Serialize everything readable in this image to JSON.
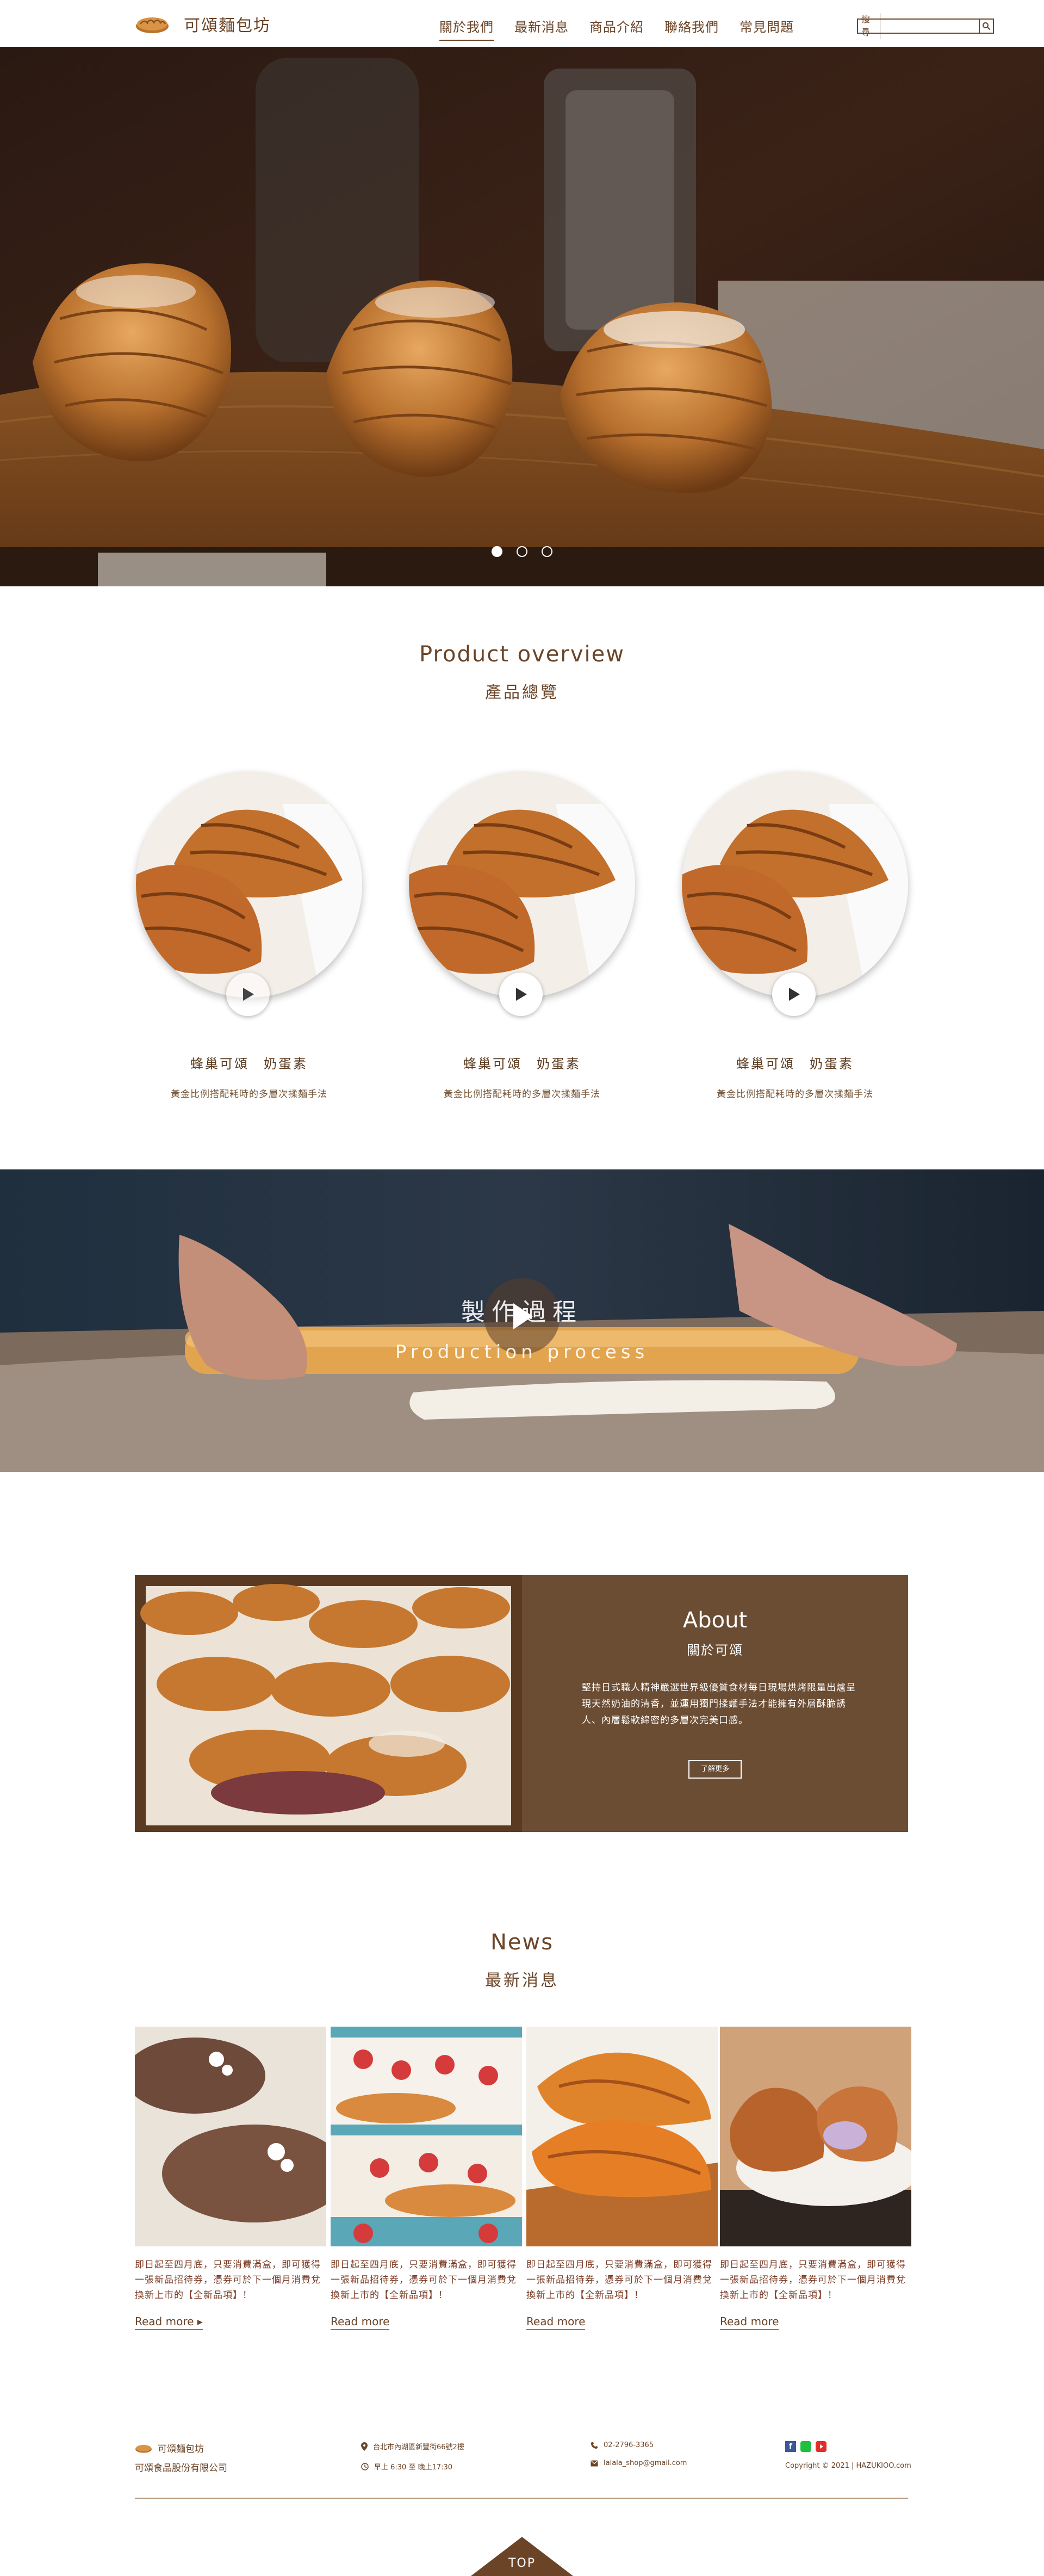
{
  "header": {
    "brand": "可頌麵包坊",
    "nav": [
      "關於我們",
      "最新消息",
      "商品介紹",
      "聯絡我們",
      "常見問題"
    ],
    "search_label": "搜尋"
  },
  "hero": {
    "slide_count": 3,
    "active_slide": 1
  },
  "products": {
    "title_en": "Product overview",
    "title_zh": "產品總覽",
    "items": [
      {
        "name": "蜂巢可頌　奶蛋素",
        "desc": "黃金比例搭配耗時的多層次揉麵手法"
      },
      {
        "name": "蜂巢可頌　奶蛋素",
        "desc": "黃金比例搭配耗時的多層次揉麵手法"
      },
      {
        "name": "蜂巢可頌　奶蛋素",
        "desc": "黃金比例搭配耗時的多層次揉麵手法"
      }
    ]
  },
  "process": {
    "title": "製作過程",
    "subtitle": "Production process"
  },
  "about": {
    "title_en": "About",
    "title_zh": "關於可頌",
    "text": "堅持日式職人精神嚴選世界級優質食材每日現場烘烤限量出爐呈現天然奶油的清香，並運用獨門揉麵手法才能擁有外層酥脆誘人、內層鬆軟綿密的多層次完美口感。",
    "more": "了解更多"
  },
  "news": {
    "title_en": "News",
    "title_zh": "最新消息",
    "items": [
      {
        "text": "即日起至四月底，只要消費滿盒，即可獲得一張新品招待券，憑券可於下一個月消費兌換新上市的【全新品項】！",
        "read": "Read more ▸"
      },
      {
        "text": "即日起至四月底，只要消費滿盒，即可獲得一張新品招待券，憑券可於下一個月消費兌換新上市的【全新品項】！",
        "read": "Read more"
      },
      {
        "text": "即日起至四月底，只要消費滿盒，即可獲得一張新品招待券，憑券可於下一個月消費兌換新上市的【全新品項】！",
        "read": "Read more"
      },
      {
        "text": "即日起至四月底，只要消費滿盒，即可獲得一張新品招待券，憑券可於下一個月消費兌換新上市的【全新品項】！",
        "read": "Read more"
      }
    ]
  },
  "footer": {
    "brand": "可頌麵包坊",
    "company": "可頌食品股份有限公司",
    "address": "台北市內湖區新豐街66號2樓",
    "hours": "早上 6:30 至 晚上17:30",
    "phone": "02-2796-3365",
    "email": "lalala_shop@gmail.com",
    "copyright": "Copyright © 2021 | HAZUKIOO.com",
    "top": "TOP"
  },
  "colors": {
    "brand": "#6b4427",
    "about_bg": "#6b4d33",
    "news_text": "#7a3a24"
  }
}
